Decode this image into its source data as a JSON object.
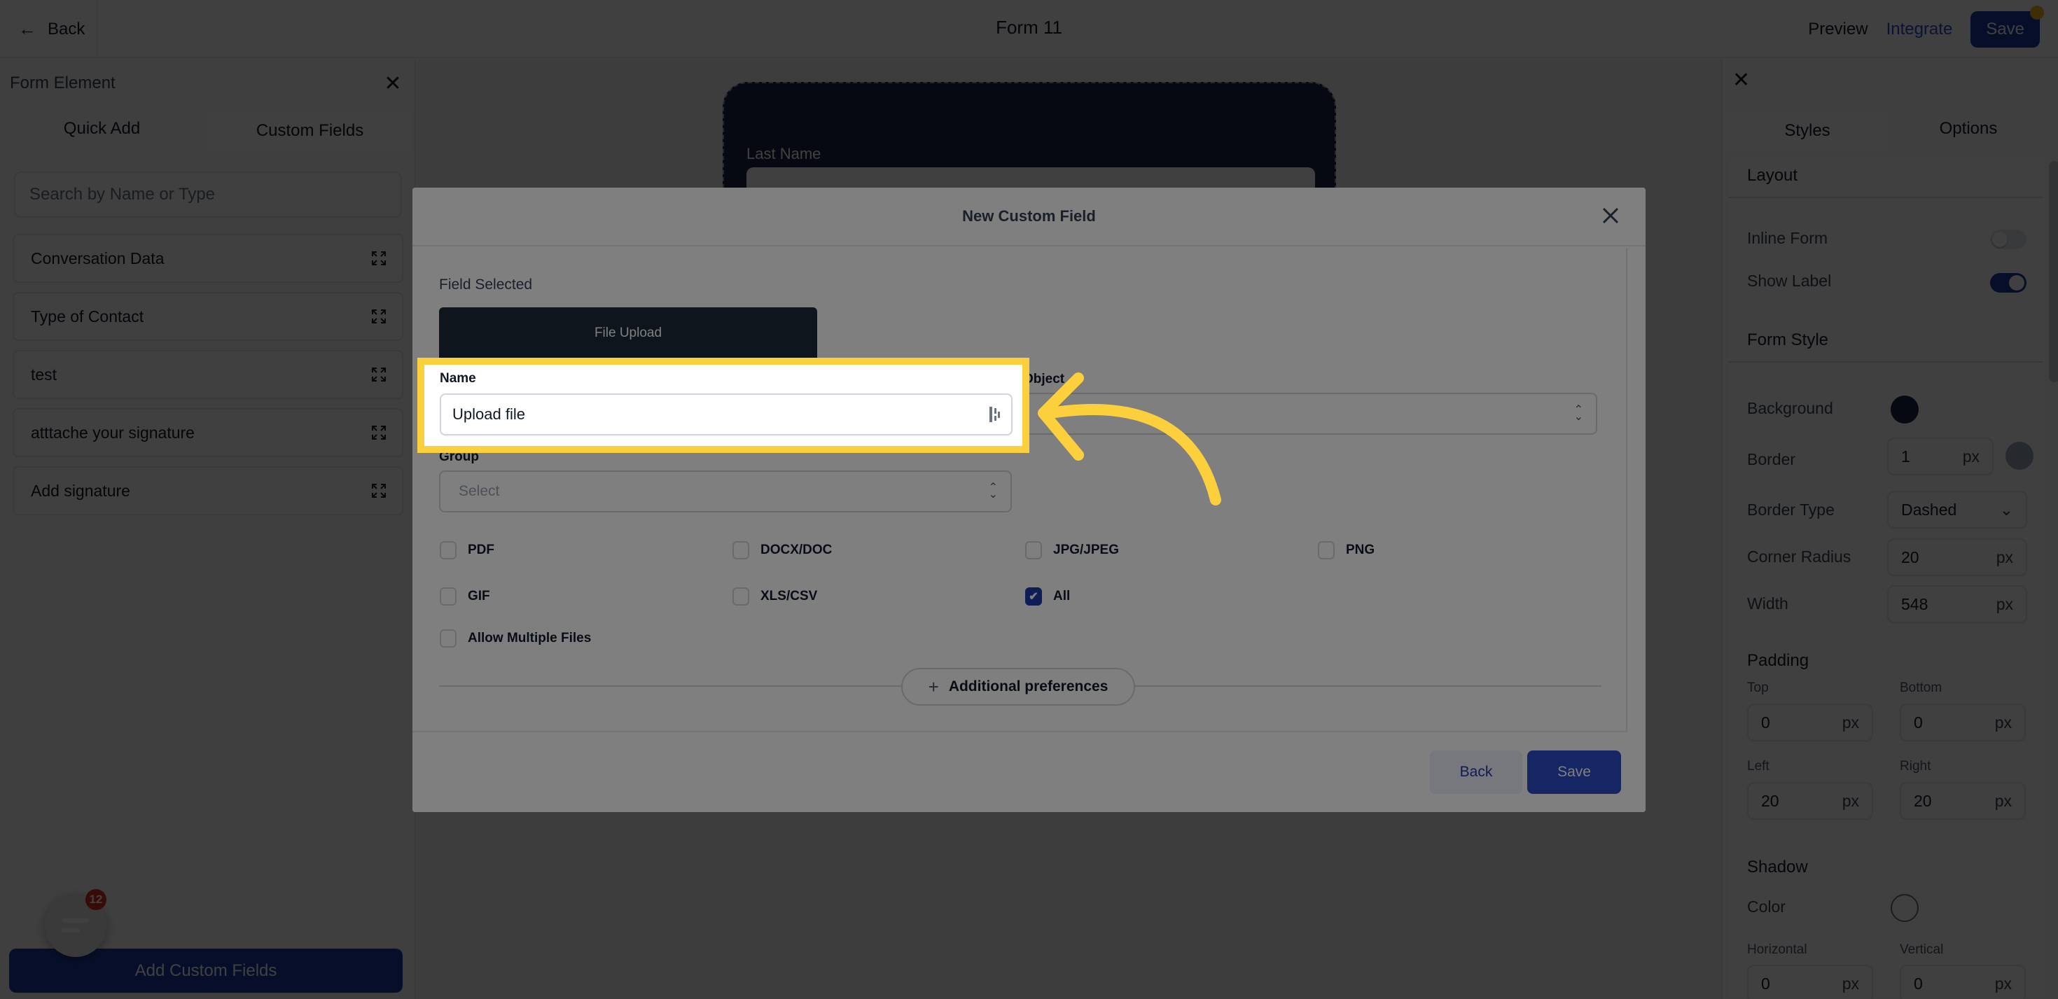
{
  "topbar": {
    "back_label": "Back",
    "form_title": "Form 11",
    "preview_label": "Preview",
    "integrate_label": "Integrate",
    "save_label": "Save"
  },
  "left_panel": {
    "title": "Form Element",
    "tabs": [
      {
        "label": "Quick Add",
        "active": false
      },
      {
        "label": "Custom Fields",
        "active": true
      }
    ],
    "search_placeholder": "Search by Name or Type",
    "items": [
      {
        "label": "Conversation Data"
      },
      {
        "label": "Type of Contact"
      },
      {
        "label": "test"
      },
      {
        "label": "atttache your signature"
      },
      {
        "label": "Add signature"
      }
    ],
    "add_button_label": "Add Custom Fields",
    "chat_badge_count": "12"
  },
  "canvas": {
    "field_label": "Last Name",
    "field_placeholder": "Last Name"
  },
  "right_panel": {
    "tabs": [
      {
        "label": "Styles",
        "active": true
      },
      {
        "label": "Options",
        "active": false
      }
    ],
    "layout_heading": "Layout",
    "inline_form_label": "Inline Form",
    "inline_form_on": false,
    "show_label_label": "Show Label",
    "show_label_on": true,
    "form_style_heading": "Form Style",
    "background_label": "Background",
    "background_color": "#1a2447",
    "border_label": "Border",
    "border_value": "1",
    "border_color": "#98a2b3",
    "border_type_label": "Border Type",
    "border_type_value": "Dashed",
    "corner_radius_label": "Corner Radius",
    "corner_radius_value": "20",
    "width_label": "Width",
    "width_value": "548",
    "unit": "px",
    "padding_heading": "Padding",
    "padding": {
      "top_label": "Top",
      "top_value": "0",
      "bottom_label": "Bottom",
      "bottom_value": "0",
      "left_label": "Left",
      "left_value": "20",
      "right_label": "Right",
      "right_value": "20"
    },
    "shadow_heading": "Shadow",
    "shadow_color_label": "Color",
    "shadow_color": "#ffffff",
    "horizontal_label": "Horizontal",
    "horizontal_value": "0",
    "vertical_label": "Vertical",
    "vertical_value": "0"
  },
  "modal": {
    "title": "New Custom Field",
    "field_selected_label": "Field Selected",
    "field_type": "File Upload",
    "name_label": "Name",
    "name_value": "Upload file",
    "object_label": "Object",
    "object_value": "",
    "group_label": "Group",
    "group_placeholder": "Select",
    "file_types": [
      {
        "label": "PDF",
        "checked": false
      },
      {
        "label": "DOCX/DOC",
        "checked": false
      },
      {
        "label": "JPG/JPEG",
        "checked": false
      },
      {
        "label": "PNG",
        "checked": false
      },
      {
        "label": "GIF",
        "checked": false
      },
      {
        "label": "XLS/CSV",
        "checked": false
      },
      {
        "label": "All",
        "checked": true
      }
    ],
    "allow_multiple_label": "Allow Multiple Files",
    "allow_multiple_checked": false,
    "additional_preferences_label": "Additional preferences",
    "back_label": "Back",
    "save_label": "Save"
  },
  "colors": {
    "accent": "#1d3ba8",
    "highlight": "#fcd03c",
    "badge": "#d92d20"
  }
}
